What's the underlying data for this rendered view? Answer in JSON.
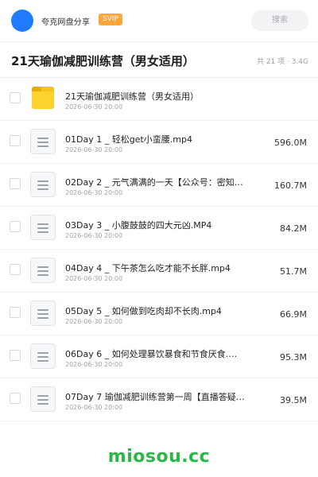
{
  "header": {
    "app_name": "夸克网盘分享",
    "badge": "SVIP",
    "search_label": "搜索",
    "avatar_color": "#1f7bff",
    "badge_color": "#ffa53a"
  },
  "folder": {
    "title": "21天瑜伽减肥训练营（男女适用）",
    "meta": "共 21 项 · 3.4G"
  },
  "files": [
    {
      "name": "21天瑜伽减肥训练营（男女适用）",
      "date": "2026-06-30 20:00",
      "size": "",
      "icon": "folder-icon"
    },
    {
      "name": "01Day 1 _ 轻松get小蛮腰.mp4",
      "date": "2026-06-30 20:00",
      "size": "596.0M",
      "icon": "document-icon"
    },
    {
      "name": "02Day 2 _ 元气满满的一天【公众号：密知圈…",
      "date": "2026-06-30 20:00",
      "size": "160.7M",
      "icon": "document-icon"
    },
    {
      "name": "03Day 3 _ 小腹鼓鼓的四大元凶.MP4",
      "date": "2026-06-30 20:00",
      "size": "84.2M",
      "icon": "document-icon"
    },
    {
      "name": "04Day 4 _ 下午茶怎么吃才能不长胖.mp4",
      "date": "2026-06-30 20:00",
      "size": "51.7M",
      "icon": "document-icon"
    },
    {
      "name": "05Day 5 _ 如何做到吃肉却不长肉.mp4",
      "date": "2026-06-30 20:00",
      "size": "66.9M",
      "icon": "document-icon"
    },
    {
      "name": "06Day 6 _ 如何处理暴饮暴食和节食厌食.m…",
      "date": "2026-06-30 20:00",
      "size": "95.3M",
      "icon": "document-icon"
    },
    {
      "name": "07Day 7  瑜伽减肥训练营第一周【直播答疑】…",
      "date": "2026-06-30 20:00",
      "size": "39.5M",
      "icon": "document-icon"
    }
  ],
  "watermark": "miosou.cc",
  "colors": {
    "watermark": "#27b845",
    "folder": "#fcd22e"
  }
}
